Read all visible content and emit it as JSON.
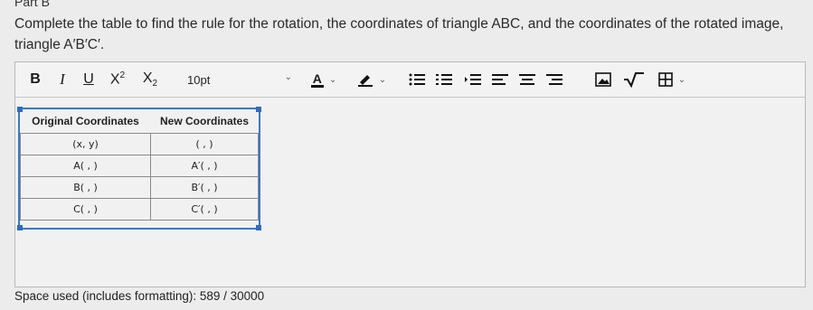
{
  "part_title": "Part B",
  "prompt": "Complete the table to find the rule for the rotation, the coordinates of triangle ABC, and the coordinates of the rotated image, triangle A′B′C′.",
  "toolbar": {
    "bold": "B",
    "italic": "I",
    "underline": "U",
    "font_size": "10pt",
    "color_letter": "A",
    "icons": [
      "bold-icon",
      "italic-icon",
      "underline-icon",
      "superscript-icon",
      "subscript-icon",
      "font-color-icon",
      "highlight-icon",
      "bullet-list-icon",
      "numbered-list-icon",
      "indent-icon",
      "align-left-icon",
      "align-center-icon",
      "align-right-icon",
      "image-icon",
      "sqrt-icon",
      "table-icon"
    ]
  },
  "table": {
    "headers": [
      "Original Coordinates",
      "New Coordinates"
    ],
    "rows": [
      [
        "(x, y)",
        "( , )"
      ],
      [
        "A( , )",
        "A′( , )"
      ],
      [
        "B( , )",
        "B′( , )"
      ],
      [
        "C( , )",
        "C′( , )"
      ]
    ]
  },
  "footer": "Space used (includes formatting): 589 / 30000",
  "colors": {
    "selection": "#3a78c9",
    "background": "#ececec"
  }
}
